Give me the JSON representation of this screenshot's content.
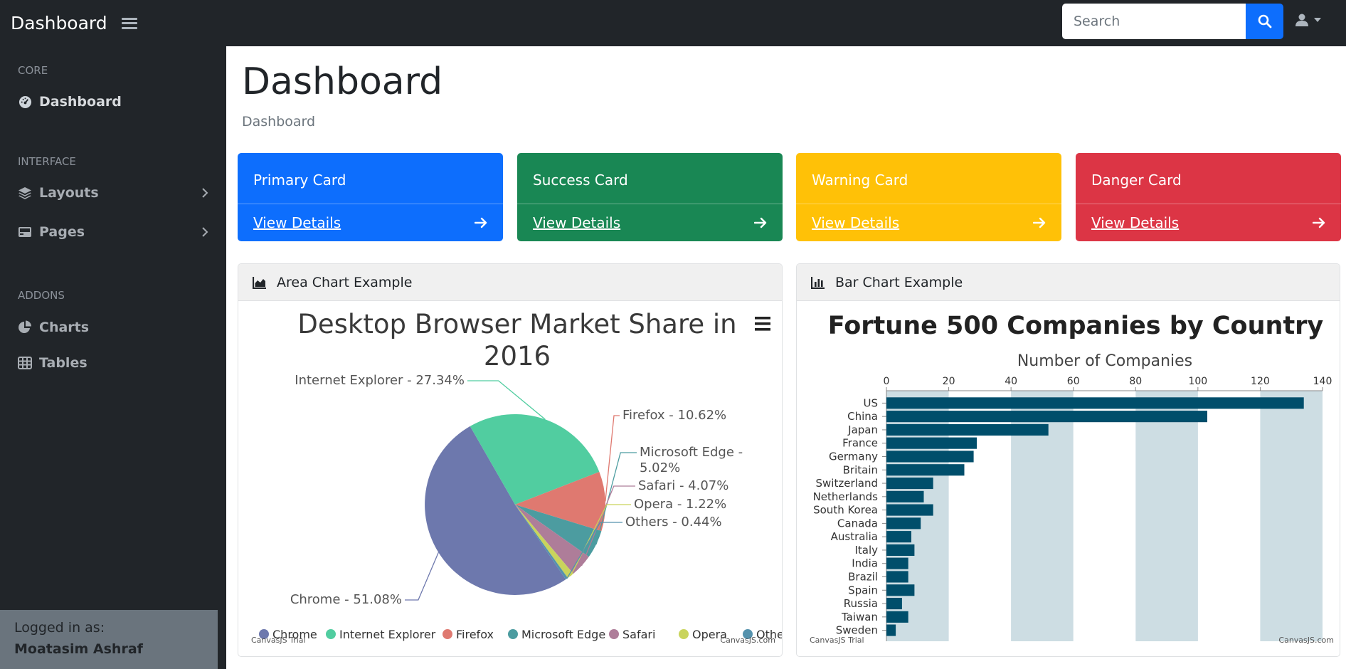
{
  "brand": "Dashboard",
  "search": {
    "placeholder": "Search"
  },
  "sidebar": {
    "sections": [
      {
        "heading": "CORE"
      },
      {
        "heading": "INTERFACE"
      },
      {
        "heading": "ADDONS"
      }
    ],
    "items": [
      {
        "label": "Dashboard",
        "icon": "tachometer-icon"
      },
      {
        "label": "Layouts",
        "icon": "layers-icon"
      },
      {
        "label": "Pages",
        "icon": "book-icon"
      },
      {
        "label": "Charts",
        "icon": "pie-chart-icon"
      },
      {
        "label": "Tables",
        "icon": "table-icon"
      }
    ],
    "footer": {
      "logged_in_label": "Logged in as:",
      "user": "Moatasim Ashraf"
    }
  },
  "page": {
    "title": "Dashboard",
    "breadcrumb": "Dashboard"
  },
  "cards": [
    {
      "title": "Primary Card",
      "link": "View Details",
      "color": "#0d6efd"
    },
    {
      "title": "Success Card",
      "link": "View Details",
      "color": "#198754"
    },
    {
      "title": "Warning Card",
      "link": "View Details",
      "color": "#ffc107"
    },
    {
      "title": "Danger Card",
      "link": "View Details",
      "color": "#dc3545"
    }
  ],
  "panels": {
    "area": {
      "header": "Area Chart Example",
      "credit_left": "CanvasJS Trial",
      "credit_right": "CanvasJS.com"
    },
    "bar": {
      "header": "Bar Chart Example",
      "credit_left": "CanvasJS Trial",
      "credit_right": "CanvasJS.com"
    }
  },
  "chart_data": [
    {
      "type": "pie",
      "title": "Desktop Browser Market Share in 2016",
      "categories": [
        "Chrome",
        "Internet Explorer",
        "Firefox",
        "Microsoft Edge",
        "Safari",
        "Opera",
        "Others"
      ],
      "values": [
        51.08,
        27.34,
        10.62,
        5.02,
        4.07,
        1.22,
        0.44
      ],
      "labels": [
        "Chrome - 51.08%",
        "Internet Explorer - 27.34%",
        "Firefox - 10.62%",
        "Microsoft Edge - 5.02%",
        "Safari - 4.07%",
        "Opera - 1.22%",
        "Others - 0.44%"
      ],
      "colors": [
        "#6d78ad",
        "#51cda0",
        "#df7970",
        "#4c9ca0",
        "#ae7d99",
        "#c9d45c",
        "#5592ad"
      ],
      "legend": "bottom"
    },
    {
      "type": "bar",
      "orientation": "horizontal",
      "title": "Fortune 500 Companies by Country",
      "subtitle": "Number of Companies",
      "categories": [
        "US",
        "China",
        "Japan",
        "France",
        "Germany",
        "Britain",
        "Switzerland",
        "Netherlands",
        "South Korea",
        "Canada",
        "Australia",
        "Italy",
        "India",
        "Brazil",
        "Spain",
        "Russia",
        "Taiwan",
        "Sweden"
      ],
      "values": [
        134,
        103,
        52,
        29,
        28,
        25,
        15,
        12,
        15,
        11,
        8,
        9,
        7,
        7,
        9,
        5,
        7,
        3
      ],
      "axis_ticks": [
        "0",
        "20",
        "40",
        "60",
        "80",
        "100",
        "120",
        "140"
      ],
      "xlim": [
        0,
        140
      ],
      "bar_color": "#004e6b",
      "band_color": "#cddde3"
    }
  ]
}
